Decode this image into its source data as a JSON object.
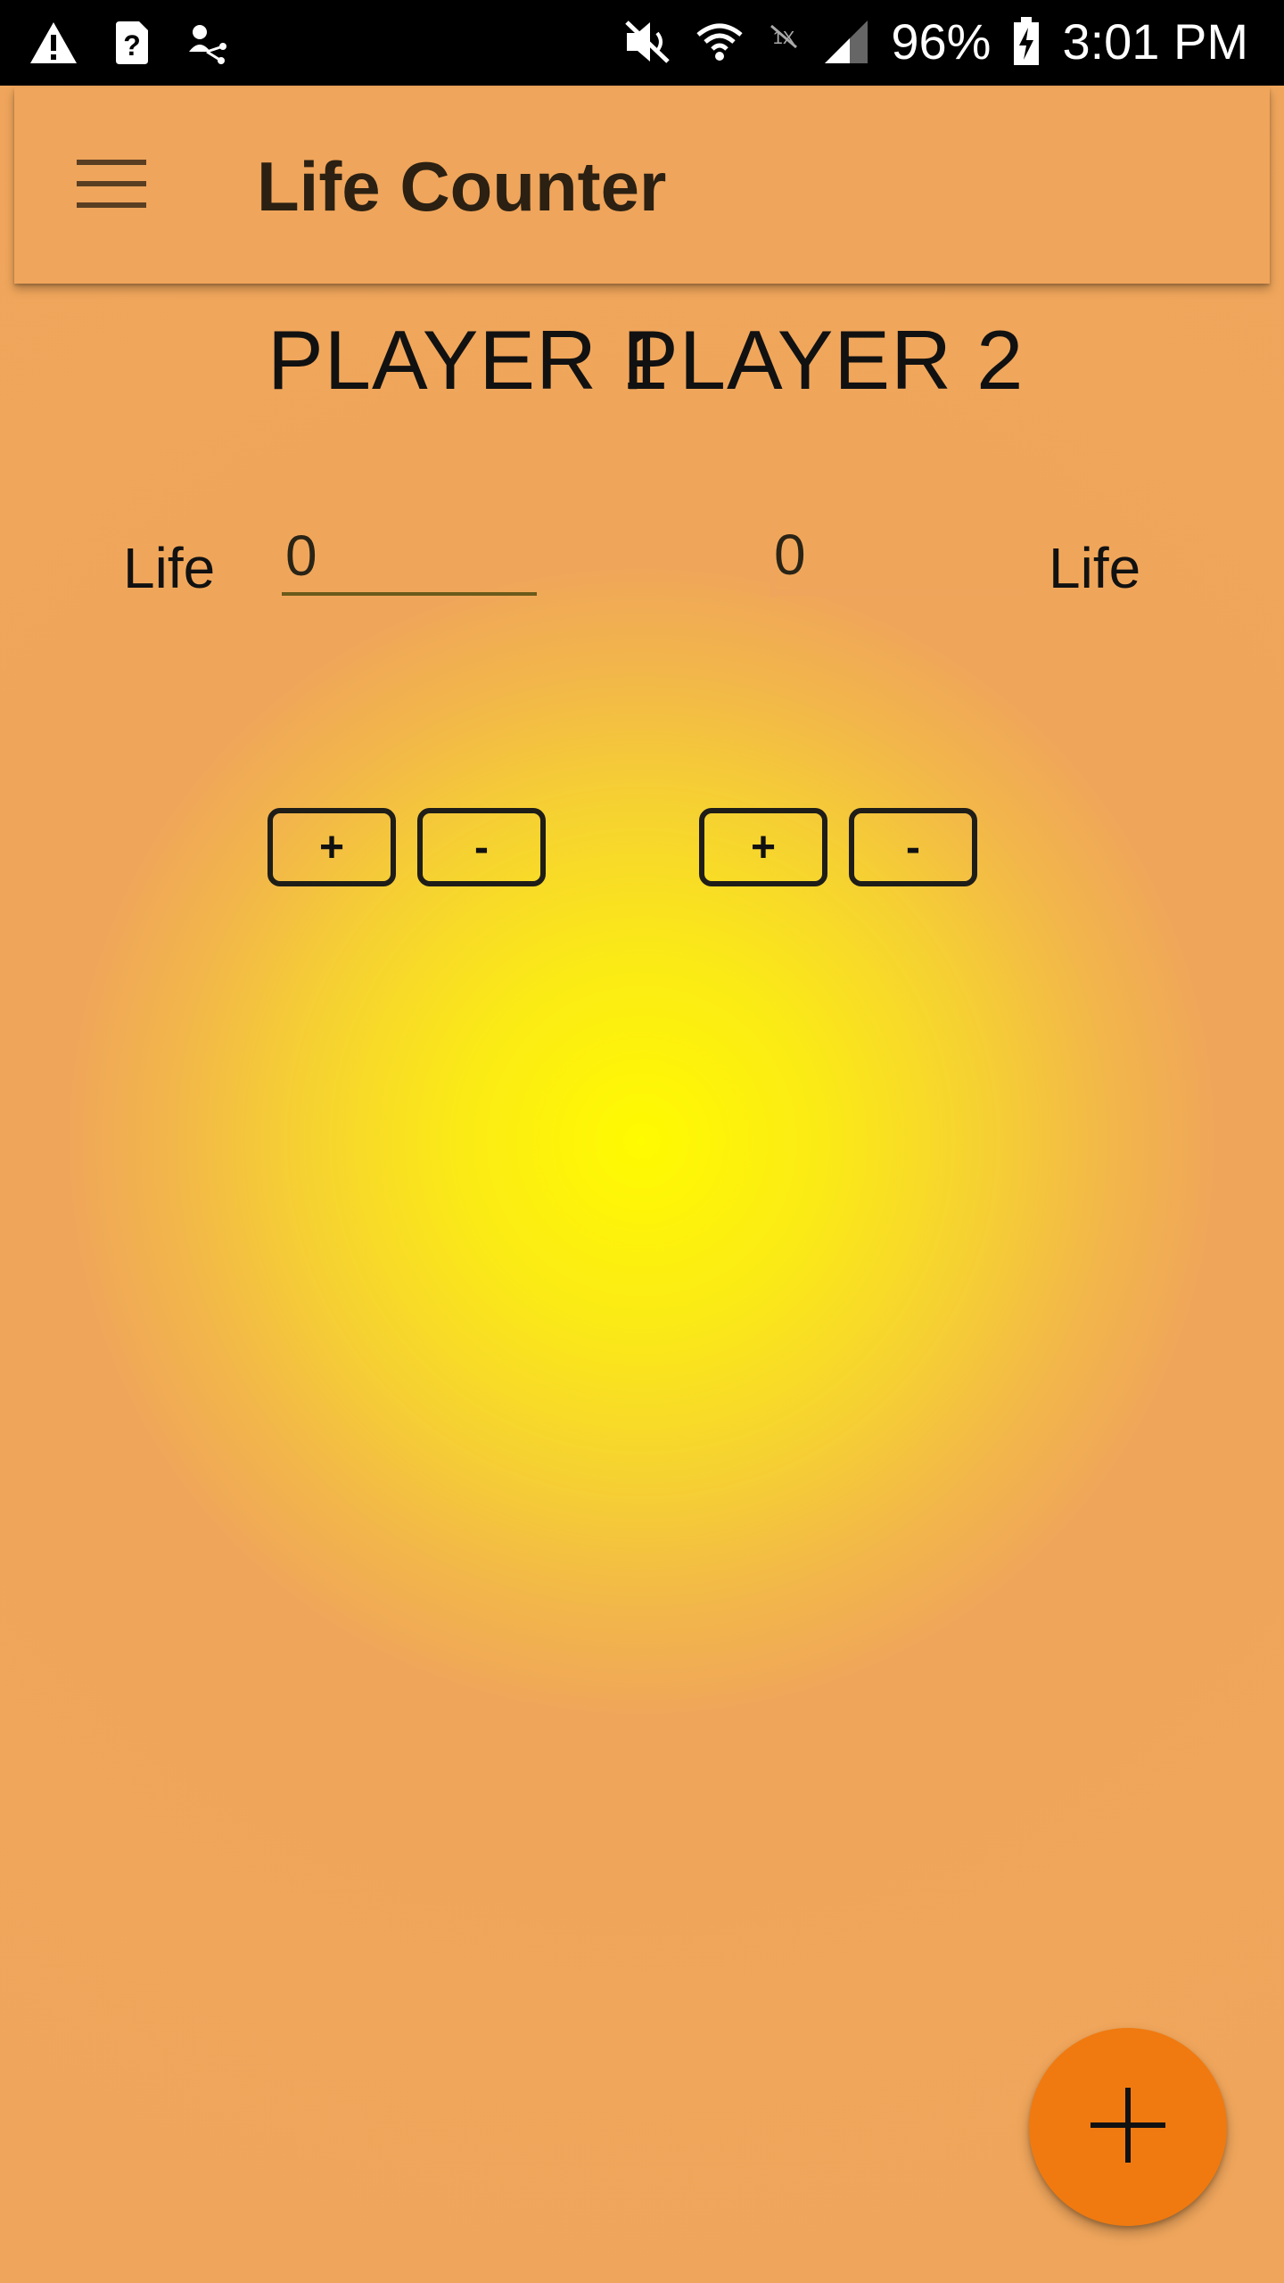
{
  "status_bar": {
    "battery": "96%",
    "time": "3:01 PM",
    "icons": [
      "warning-icon",
      "sim-question-icon",
      "usb-share-icon",
      "mute-icon",
      "wifi-icon",
      "no-network-icon",
      "signal-icon",
      "battery-charging-icon"
    ]
  },
  "app_bar": {
    "title": "Life Counter",
    "menu_icon": "menu-icon"
  },
  "players": [
    {
      "heading": "PLAYER 1",
      "life_label": "Life",
      "life_value": "0",
      "plus_label": "+",
      "minus_label": "-"
    },
    {
      "heading": "PLAYER 2",
      "life_label": "Life",
      "life_value": "0",
      "plus_label": "+",
      "minus_label": "-"
    }
  ],
  "fab": {
    "icon": "plus-icon"
  },
  "colors": {
    "background_center": "#fffb00",
    "background_edge": "#efa55c",
    "app_bar": "#efa55c",
    "fab": "#f07a10",
    "text_dark": "#111111"
  }
}
